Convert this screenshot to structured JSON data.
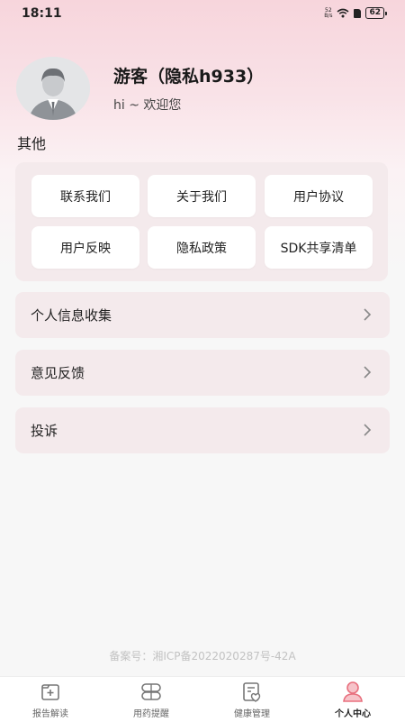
{
  "status_bar": {
    "time": "18:11",
    "net_speed_value": "52",
    "net_speed_unit": "B/s",
    "battery": "62"
  },
  "profile": {
    "name": "游客（隐私h933）",
    "greeting": "hi ~ 欢迎您"
  },
  "other_section": {
    "title": "其他",
    "buttons": [
      {
        "label": "联系我们"
      },
      {
        "label": "关于我们"
      },
      {
        "label": "用户协议"
      },
      {
        "label": "用户反映"
      },
      {
        "label": "隐私政策"
      },
      {
        "label": "SDK共享清单"
      }
    ]
  },
  "list_rows": [
    {
      "label": "个人信息收集"
    },
    {
      "label": "意见反馈"
    },
    {
      "label": "投诉"
    }
  ],
  "footer": {
    "icp": "备案号：湘ICP备2022020287号-42A"
  },
  "tabbar": {
    "tabs": [
      {
        "label": "报告解读",
        "icon": "report-icon",
        "active": false
      },
      {
        "label": "用药提醒",
        "icon": "pill-icon",
        "active": false
      },
      {
        "label": "健康管理",
        "icon": "health-icon",
        "active": false
      },
      {
        "label": "个人中心",
        "icon": "person-icon",
        "active": true
      }
    ]
  },
  "colors": {
    "accent": "#e8707e",
    "card_bg": "#f4eaec",
    "header_pink": "#f7d5dc"
  }
}
